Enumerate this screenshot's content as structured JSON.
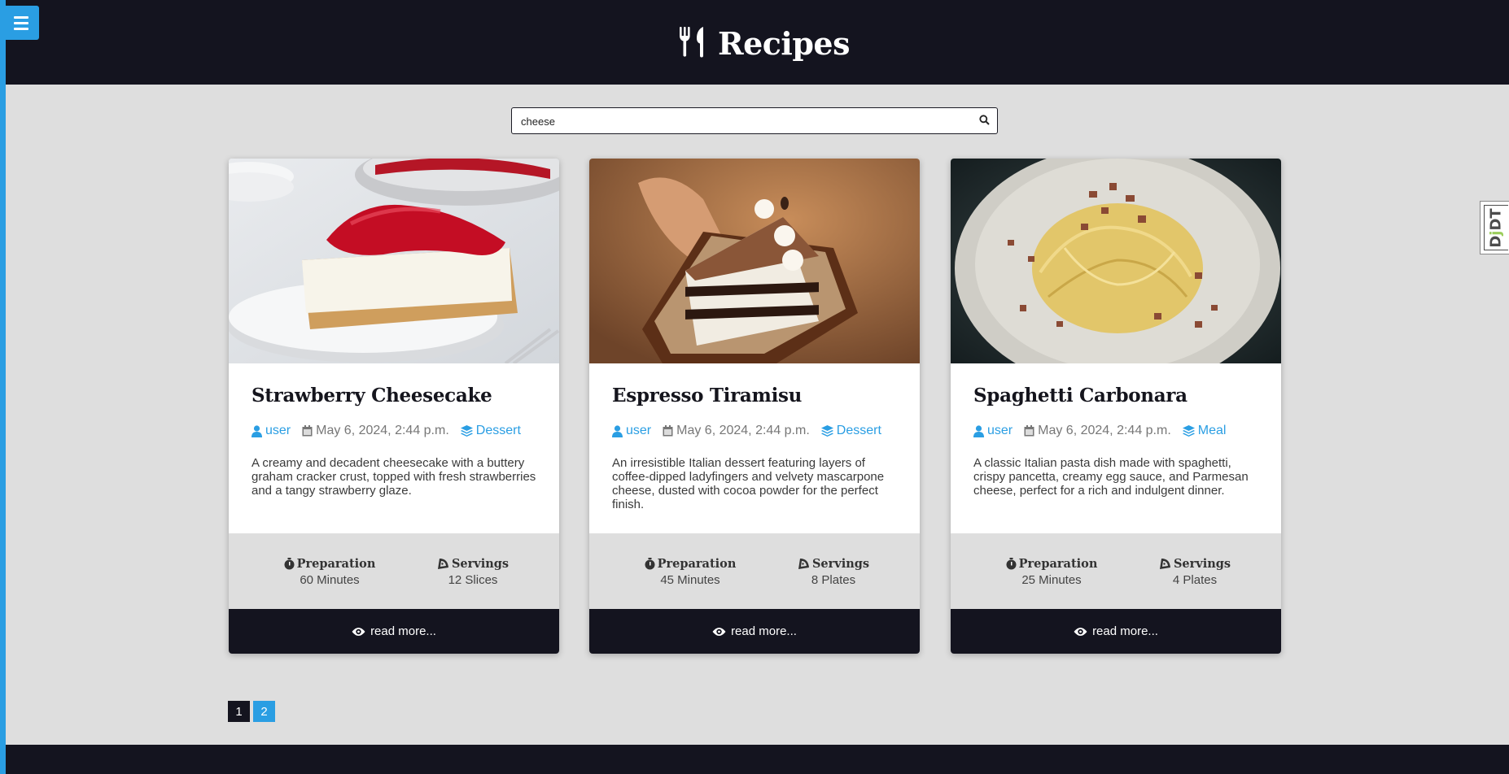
{
  "header": {
    "title": "Recipes"
  },
  "search": {
    "value": "cheese"
  },
  "cards": [
    {
      "title": "Strawberry Cheesecake",
      "author": "user",
      "date": "May 6, 2024, 2:44 p.m.",
      "category": "Dessert",
      "description": "A creamy and decadent cheesecake with a buttery graham cracker crust, topped with fresh strawberries and a tangy strawberry glaze.",
      "prep_label": "Preparation",
      "prep_value": "60 Minutes",
      "serv_label": "Servings",
      "serv_value": "12 Slices",
      "read_more": "read more..."
    },
    {
      "title": "Espresso Tiramisu",
      "author": "user",
      "date": "May 6, 2024, 2:44 p.m.",
      "category": "Dessert",
      "description": "An irresistible Italian dessert featuring layers of coffee-dipped ladyfingers and velvety mascarpone cheese, dusted with cocoa powder for the perfect finish.",
      "prep_label": "Preparation",
      "prep_value": "45 Minutes",
      "serv_label": "Servings",
      "serv_value": "8 Plates",
      "read_more": "read more..."
    },
    {
      "title": "Spaghetti Carbonara",
      "author": "user",
      "date": "May 6, 2024, 2:44 p.m.",
      "category": "Meal",
      "description": "A classic Italian pasta dish made with spaghetti, crispy pancetta, creamy egg sauce, and Parmesan cheese, perfect for a rich and indulgent dinner.",
      "prep_label": "Preparation",
      "prep_value": "25 Minutes",
      "serv_label": "Servings",
      "serv_value": "4 Plates",
      "read_more": "read more..."
    }
  ],
  "pagination": {
    "pages": [
      "1",
      "2"
    ],
    "current": "1"
  },
  "debug_toolbar": {
    "label_d": "D",
    "label_j": "j",
    "label_dt": "DT"
  },
  "colors": {
    "accent": "#2a9ee3",
    "dark": "#14141f",
    "background": "#dedede"
  }
}
